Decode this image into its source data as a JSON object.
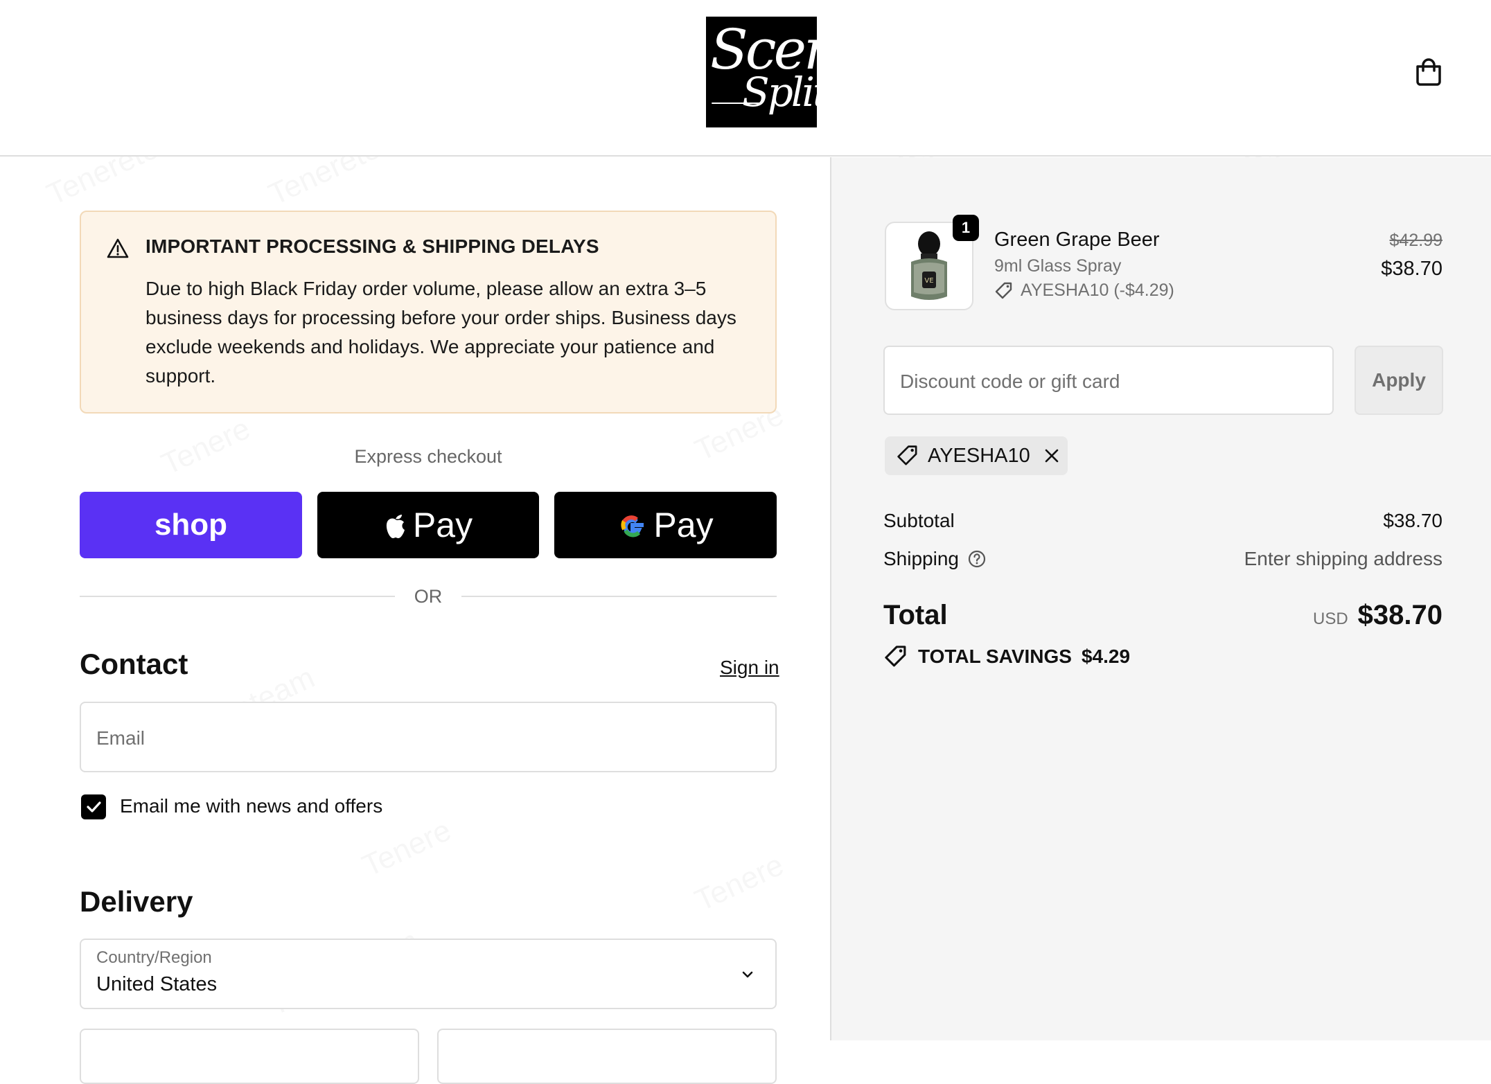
{
  "header": {
    "logo_line1": "Scent",
    "logo_line2": "Split",
    "cart_icon": "shopping-bag-icon"
  },
  "notice": {
    "icon": "warning-triangle-icon",
    "title": "IMPORTANT PROCESSING & SHIPPING DELAYS",
    "body": "Due to high Black Friday order volume, please allow an extra 3–5 business days for processing before your order ships. Business days exclude weekends and holidays. We appreciate your patience and support."
  },
  "express": {
    "label": "Express checkout",
    "shop_label": "shop",
    "apple_label": "Pay",
    "google_label": "Pay",
    "or": "OR",
    "colors": {
      "shop": "#5a31f4",
      "apple": "#000000",
      "google": "#000000"
    }
  },
  "contact": {
    "heading": "Contact",
    "sign_in": "Sign in",
    "email_placeholder": "Email",
    "newsletter_label": "Email me with news and offers",
    "newsletter_checked": true
  },
  "delivery": {
    "heading": "Delivery",
    "country_label": "Country/Region",
    "country_value": "United States"
  },
  "order": {
    "item": {
      "name": "Green Grape Beer",
      "variant": "9ml Glass Spray",
      "discount": "AYESHA10 (-$4.29)",
      "original_price": "$42.99",
      "price": "$38.70",
      "quantity": "1"
    },
    "discount_placeholder": "Discount code or gift card",
    "apply_label": "Apply",
    "applied_code": "AYESHA10",
    "subtotal_label": "Subtotal",
    "subtotal_value": "$38.70",
    "shipping_label": "Shipping",
    "shipping_value": "Enter shipping address",
    "total_label": "Total",
    "total_currency": "USD",
    "total_value": "$38.70",
    "savings_label": "TOTAL SAVINGS",
    "savings_value": "$4.29"
  }
}
